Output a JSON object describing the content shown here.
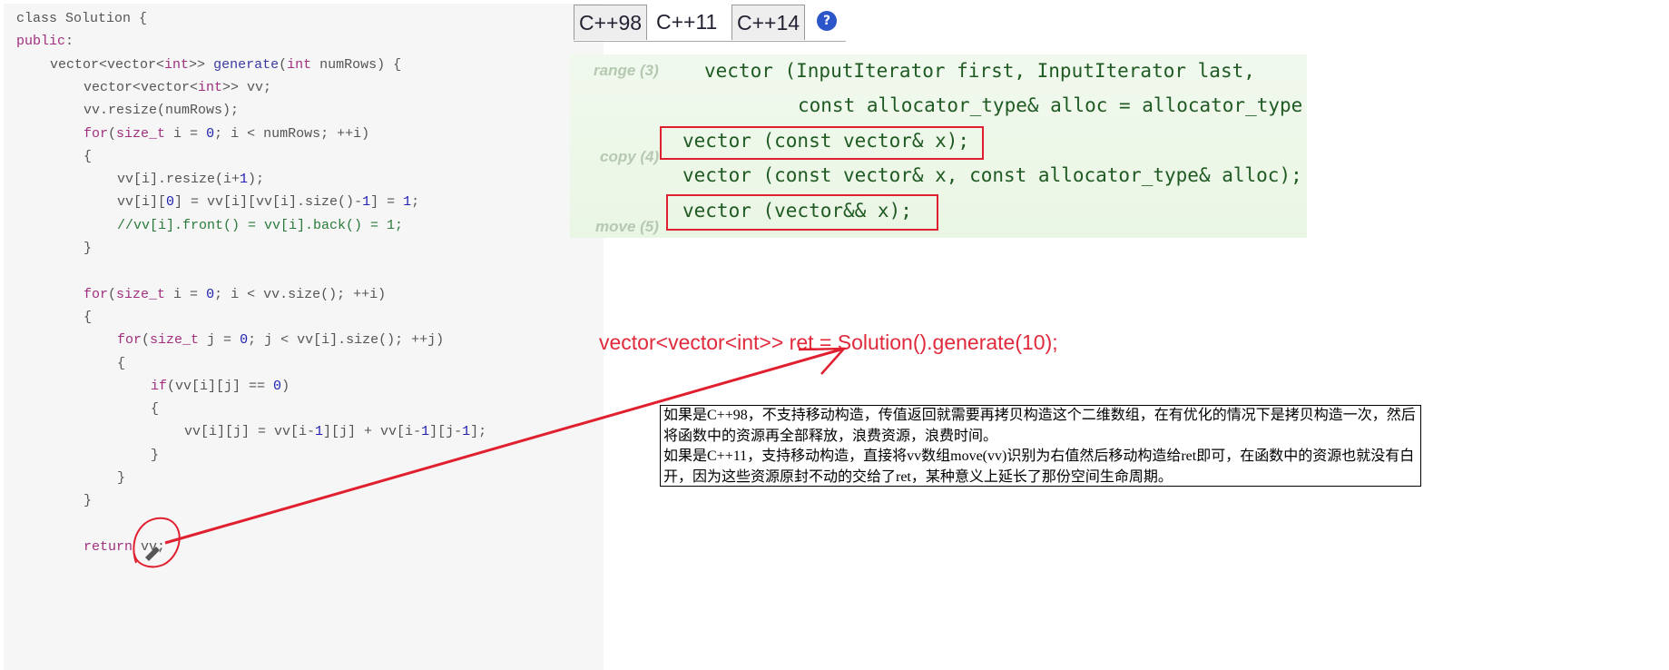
{
  "code": {
    "lines": [
      {
        "indent": 0,
        "parts": [
          [
            "",
            "class Solution {"
          ]
        ]
      },
      {
        "indent": 0,
        "parts": [
          [
            "kw",
            "public"
          ],
          [
            "",
            ":"
          ]
        ]
      },
      {
        "indent": 1,
        "parts": [
          [
            "",
            "vector<vector<"
          ],
          [
            "kw",
            "int"
          ],
          [
            "",
            ">> "
          ],
          [
            "fn",
            "generate"
          ],
          [
            "",
            "("
          ],
          [
            "kw",
            "int"
          ],
          [
            "",
            " numRows) {"
          ]
        ]
      },
      {
        "indent": 2,
        "parts": [
          [
            "",
            "vector<vector<"
          ],
          [
            "kw",
            "int"
          ],
          [
            "",
            ">> vv;"
          ]
        ]
      },
      {
        "indent": 2,
        "parts": [
          [
            "",
            "vv.resize(numRows);"
          ]
        ]
      },
      {
        "indent": 2,
        "parts": [
          [
            "kw",
            "for"
          ],
          [
            "",
            "("
          ],
          [
            "kw",
            "size_t"
          ],
          [
            "",
            " i = "
          ],
          [
            "num",
            "0"
          ],
          [
            "",
            "; i < numRows; ++i)"
          ]
        ]
      },
      {
        "indent": 2,
        "parts": [
          [
            "",
            "{"
          ]
        ]
      },
      {
        "indent": 3,
        "parts": [
          [
            "",
            "vv[i].resize(i+"
          ],
          [
            "num",
            "1"
          ],
          [
            "",
            ");"
          ]
        ]
      },
      {
        "indent": 3,
        "parts": [
          [
            "",
            "vv[i]["
          ],
          [
            "num",
            "0"
          ],
          [
            "",
            "] = vv[i][vv[i].size()-"
          ],
          [
            "num",
            "1"
          ],
          [
            "",
            "] = "
          ],
          [
            "num",
            "1"
          ],
          [
            "",
            ";"
          ]
        ]
      },
      {
        "indent": 3,
        "parts": [
          [
            "cm",
            "//vv[i].front() = vv[i].back() = 1;"
          ]
        ]
      },
      {
        "indent": 2,
        "parts": [
          [
            "",
            "}"
          ]
        ]
      },
      {
        "indent": 0,
        "parts": []
      },
      {
        "indent": 2,
        "parts": [
          [
            "kw",
            "for"
          ],
          [
            "",
            "("
          ],
          [
            "kw",
            "size_t"
          ],
          [
            "",
            " i = "
          ],
          [
            "num",
            "0"
          ],
          [
            "",
            "; i < vv.size(); ++i)"
          ]
        ]
      },
      {
        "indent": 2,
        "parts": [
          [
            "",
            "{"
          ]
        ]
      },
      {
        "indent": 3,
        "parts": [
          [
            "kw",
            "for"
          ],
          [
            "",
            "("
          ],
          [
            "kw",
            "size_t"
          ],
          [
            "",
            " j = "
          ],
          [
            "num",
            "0"
          ],
          [
            "",
            "; j < vv[i].size(); ++j)"
          ]
        ]
      },
      {
        "indent": 3,
        "parts": [
          [
            "",
            "{"
          ]
        ]
      },
      {
        "indent": 4,
        "parts": [
          [
            "kw",
            "if"
          ],
          [
            "",
            "(vv[i][j] == "
          ],
          [
            "num",
            "0"
          ],
          [
            "",
            ")"
          ]
        ]
      },
      {
        "indent": 4,
        "parts": [
          [
            "",
            "{"
          ]
        ]
      },
      {
        "indent": 5,
        "parts": [
          [
            "",
            "vv[i][j] = vv[i-"
          ],
          [
            "num",
            "1"
          ],
          [
            "",
            "][j] + vv[i-"
          ],
          [
            "num",
            "1"
          ],
          [
            "",
            "][j-"
          ],
          [
            "num",
            "1"
          ],
          [
            "",
            "];"
          ]
        ]
      },
      {
        "indent": 4,
        "parts": [
          [
            "",
            "}"
          ]
        ]
      },
      {
        "indent": 3,
        "parts": [
          [
            "",
            "}"
          ]
        ]
      },
      {
        "indent": 2,
        "parts": [
          [
            "",
            "}"
          ]
        ]
      },
      {
        "indent": 0,
        "parts": []
      },
      {
        "indent": 2,
        "parts": [
          [
            "kw",
            "return"
          ],
          [
            "",
            " vv;"
          ]
        ]
      }
    ]
  },
  "tabs": [
    {
      "label": "C++98",
      "boxed": true
    },
    {
      "label": "C++11",
      "boxed": false,
      "active": true
    },
    {
      "label": "C++14",
      "boxed": true
    }
  ],
  "help_icon": "?",
  "reference": {
    "range_label": "range (3)",
    "copy_label": "copy (4)",
    "move_label": "move (5)",
    "lines": [
      "vector (InputIterator first, InputIterator last,",
      "const allocator_type& alloc = allocator_type",
      "vector (const vector& x);",
      "vector (const vector& x, const allocator_type& alloc);",
      "vector (vector&& x);"
    ]
  },
  "call_expression": "vector<vector<int>> ret = Solution().generate(10);",
  "note": [
    "如果是C++98，不支持移动构造，传值返回就需要再拷贝构造这个二维数组，在有优化的情况下是拷贝构造一次，然后将函数中的资源再全部释放，浪费资源，浪费时间。",
    "如果是C++11，支持移动构造，直接将vv数组move(vv)识别为右值然后移动构造给ret即可，在函数中的资源也就没有白开，因为这些资源原封不动的交给了ret，某种意义上延长了那份空间生命周期。"
  ],
  "colors": {
    "annotation_red": "#e02030",
    "code_keyword": "#a0307f",
    "reference_green": "#1f5a23"
  }
}
